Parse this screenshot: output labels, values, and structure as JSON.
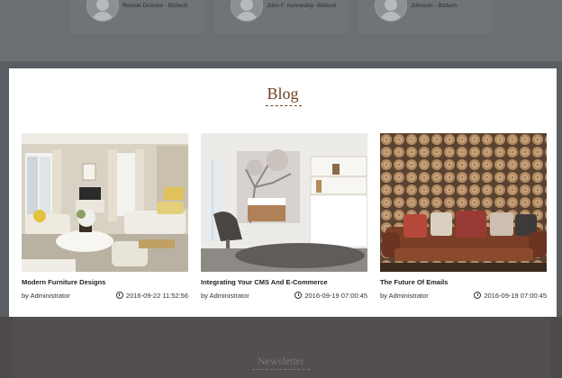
{
  "testimonials": [
    {
      "name": "Ronnie Director - Biztech"
    },
    {
      "name": "John F. Kenneddy- Biztech"
    },
    {
      "name": "Johnson - Biztech"
    }
  ],
  "blog": {
    "title": "Blog",
    "posts": [
      {
        "title": "Modern Furniture Designs",
        "author": "by Administrator",
        "date": "2016-09-22 11:52:56",
        "image": "living-room-photo"
      },
      {
        "title": "Integrating Your CMS And E-Commerce",
        "author": "by Administrator",
        "date": "2016-09-19 07:00:45",
        "image": "white-interior-photo"
      },
      {
        "title": "The Future Of Emails",
        "author": "by Administrator",
        "date": "2016-09-19 07:00:45",
        "image": "wood-log-wall-sofa-photo"
      }
    ]
  },
  "newsletter": {
    "title": "Newsletter"
  },
  "colors": {
    "accent": "#6b3e22",
    "overlay": "#5a5d62"
  }
}
